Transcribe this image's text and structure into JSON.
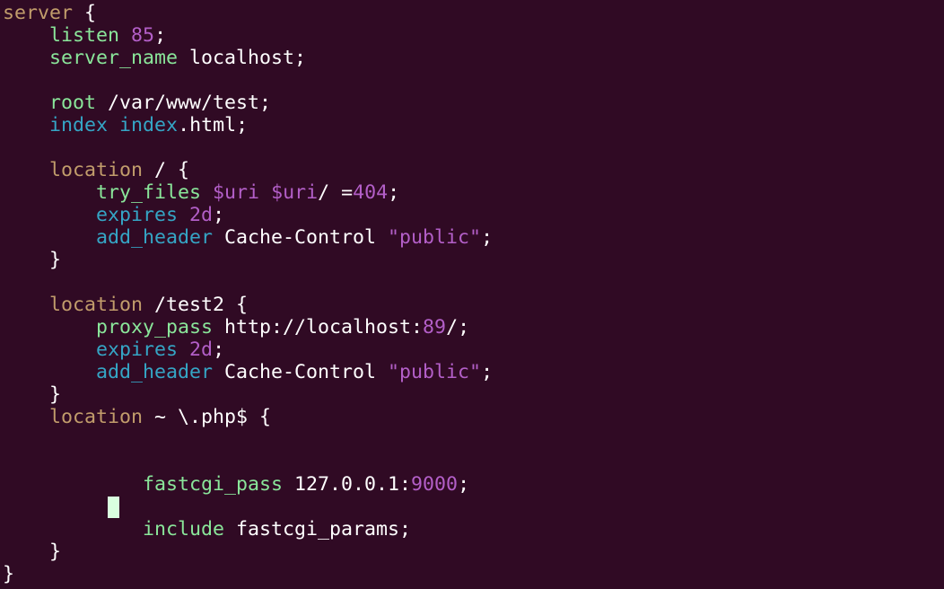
{
  "editor": {
    "background": "#300a24",
    "palette": {
      "text": "#ffffff",
      "block_keyword": "#c19c6b",
      "directive": "#8ae69a",
      "directive_alt": "#35a5c5",
      "number": "#b35fc8",
      "cursor": "#d9ffdf"
    },
    "lines": [
      [
        {
          "t": "server",
          "c": "brown"
        },
        {
          "t": " {",
          "c": "white"
        }
      ],
      [
        {
          "t": "    ",
          "c": "white"
        },
        {
          "t": "listen",
          "c": "green"
        },
        {
          "t": " ",
          "c": "white"
        },
        {
          "t": "85",
          "c": "purple"
        },
        {
          "t": ";",
          "c": "white"
        }
      ],
      [
        {
          "t": "    ",
          "c": "white"
        },
        {
          "t": "server_name",
          "c": "green"
        },
        {
          "t": " localhost;",
          "c": "white"
        }
      ],
      [],
      [
        {
          "t": "    ",
          "c": "white"
        },
        {
          "t": "root",
          "c": "green"
        },
        {
          "t": " /var/www/test;",
          "c": "white"
        }
      ],
      [
        {
          "t": "    ",
          "c": "white"
        },
        {
          "t": "index",
          "c": "teal"
        },
        {
          "t": " ",
          "c": "white"
        },
        {
          "t": "index",
          "c": "teal"
        },
        {
          "t": ".html;",
          "c": "white"
        }
      ],
      [],
      [
        {
          "t": "    ",
          "c": "white"
        },
        {
          "t": "location",
          "c": "brown"
        },
        {
          "t": " / {",
          "c": "white"
        }
      ],
      [
        {
          "t": "        ",
          "c": "white"
        },
        {
          "t": "try_files",
          "c": "green"
        },
        {
          "t": " ",
          "c": "white"
        },
        {
          "t": "$uri",
          "c": "purple"
        },
        {
          "t": " ",
          "c": "white"
        },
        {
          "t": "$uri",
          "c": "purple"
        },
        {
          "t": "/ =",
          "c": "white"
        },
        {
          "t": "404",
          "c": "purple"
        },
        {
          "t": ";",
          "c": "white"
        }
      ],
      [
        {
          "t": "        ",
          "c": "white"
        },
        {
          "t": "expires",
          "c": "teal"
        },
        {
          "t": " ",
          "c": "white"
        },
        {
          "t": "2d",
          "c": "purple"
        },
        {
          "t": ";",
          "c": "white"
        }
      ],
      [
        {
          "t": "        ",
          "c": "white"
        },
        {
          "t": "add_header",
          "c": "teal"
        },
        {
          "t": " Cache-Control ",
          "c": "white"
        },
        {
          "t": "\"public\"",
          "c": "purple"
        },
        {
          "t": ";",
          "c": "white"
        }
      ],
      [
        {
          "t": "    }",
          "c": "white"
        }
      ],
      [],
      [
        {
          "t": "    ",
          "c": "white"
        },
        {
          "t": "location",
          "c": "brown"
        },
        {
          "t": " /test2 {",
          "c": "white"
        }
      ],
      [
        {
          "t": "        ",
          "c": "white"
        },
        {
          "t": "proxy_pass",
          "c": "green"
        },
        {
          "t": " http://localhost:",
          "c": "white"
        },
        {
          "t": "89",
          "c": "purple"
        },
        {
          "t": "/;",
          "c": "white"
        }
      ],
      [
        {
          "t": "        ",
          "c": "white"
        },
        {
          "t": "expires",
          "c": "teal"
        },
        {
          "t": " ",
          "c": "white"
        },
        {
          "t": "2d",
          "c": "purple"
        },
        {
          "t": ";",
          "c": "white"
        }
      ],
      [
        {
          "t": "        ",
          "c": "white"
        },
        {
          "t": "add_header",
          "c": "teal"
        },
        {
          "t": " Cache-Control ",
          "c": "white"
        },
        {
          "t": "\"public\"",
          "c": "purple"
        },
        {
          "t": ";",
          "c": "white"
        }
      ],
      [
        {
          "t": "    }",
          "c": "white"
        }
      ],
      [
        {
          "t": "    ",
          "c": "white"
        },
        {
          "t": "location",
          "c": "brown"
        },
        {
          "t": " ~ \\.php$ {",
          "c": "white"
        }
      ],
      [],
      [],
      [
        {
          "t": "            ",
          "c": "white"
        },
        {
          "t": "fastcgi_pass",
          "c": "green"
        },
        {
          "t": " 127.0.0.1:",
          "c": "white"
        },
        {
          "t": "9000",
          "c": "purple"
        },
        {
          "t": ";",
          "c": "white"
        }
      ],
      [],
      [
        {
          "t": "            ",
          "c": "white"
        },
        {
          "t": "include",
          "c": "green"
        },
        {
          "t": " fastcgi_params;",
          "c": "white"
        }
      ],
      [
        {
          "t": "    }",
          "c": "white"
        }
      ],
      [
        {
          "t": "}",
          "c": "white"
        }
      ]
    ]
  }
}
